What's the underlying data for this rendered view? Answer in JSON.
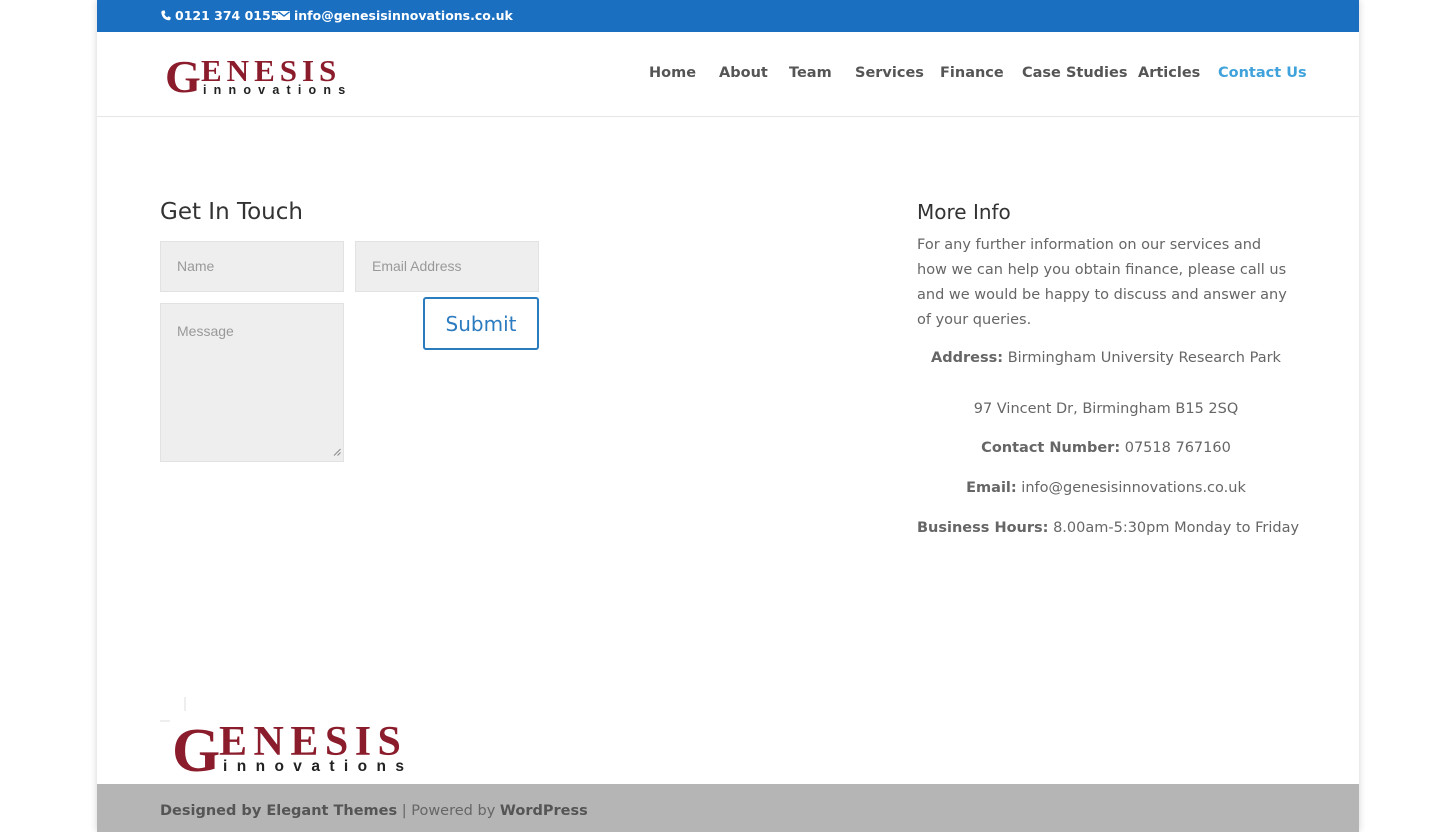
{
  "topbar": {
    "phone": "0121 374 0155",
    "email": "info@genesisinnovations.co.uk",
    "background": "#1a6fc1"
  },
  "logo": {
    "brand": "GENESIS",
    "sub": "innovations",
    "brand_color": "#8b1c2c"
  },
  "nav": {
    "items": [
      {
        "label": "Home"
      },
      {
        "label": "About"
      },
      {
        "label": "Team"
      },
      {
        "label": "Services"
      },
      {
        "label": "Finance"
      },
      {
        "label": "Case Studies"
      },
      {
        "label": "Articles"
      },
      {
        "label": "Contact Us",
        "active": true
      }
    ],
    "active_color": "#3fa2db"
  },
  "contact_form": {
    "title": "Get In Touch",
    "name_placeholder": "Name",
    "email_placeholder": "Email Address",
    "message_placeholder": "Message",
    "submit_label": "Submit"
  },
  "more_info": {
    "title": "More Info",
    "intro": "For any further information on our services and how we can help you obtain finance, please call us and we would be happy to discuss and answer any of your queries.",
    "address_label": "Address:",
    "address_line1": "Birmingham University Research Park",
    "address_line2": "97 Vincent Dr, Birmingham B15 2SQ",
    "contact_label": "Contact Number:",
    "contact_value": "07518 767160",
    "email_label": "Email:",
    "email_value": "info@genesisinnovations.co.uk",
    "hours_label": "Business Hours:",
    "hours_value": "8.00am-5:30pm Monday to Friday"
  },
  "footer": {
    "designed_by": "Designed by Elegant Themes",
    "separator": "| Powered by",
    "powered_by": "WordPress"
  }
}
